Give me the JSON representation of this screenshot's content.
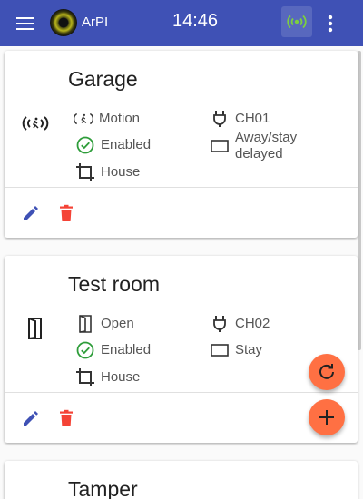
{
  "app": {
    "title": "ArPI",
    "time": "14:46",
    "connection_icon": "wifi-tethering-icon",
    "connection_color": "#7ccf3f",
    "bar_color": "#3f51b5"
  },
  "sensors": [
    {
      "name": "Garage",
      "type_icon": "motion-sensor-icon",
      "type": "Motion",
      "status": "Enabled",
      "area": "House",
      "channel": "CH01",
      "mode": "Away/stay delayed",
      "mode_line1": "Away/stay",
      "mode_line2": "delayed"
    },
    {
      "name": "Test room",
      "type_icon": "door-icon",
      "type": "Open",
      "status": "Enabled",
      "area": "House",
      "channel": "CH02",
      "mode": "Stay"
    },
    {
      "name": "Tamper"
    }
  ],
  "colors": {
    "edit": "#3f51b5",
    "delete": "#f44336",
    "enabled": "#2e9d3a",
    "fab": "#ff7043"
  },
  "fabs": {
    "refresh_icon": "refresh-icon",
    "add_icon": "add-icon"
  }
}
